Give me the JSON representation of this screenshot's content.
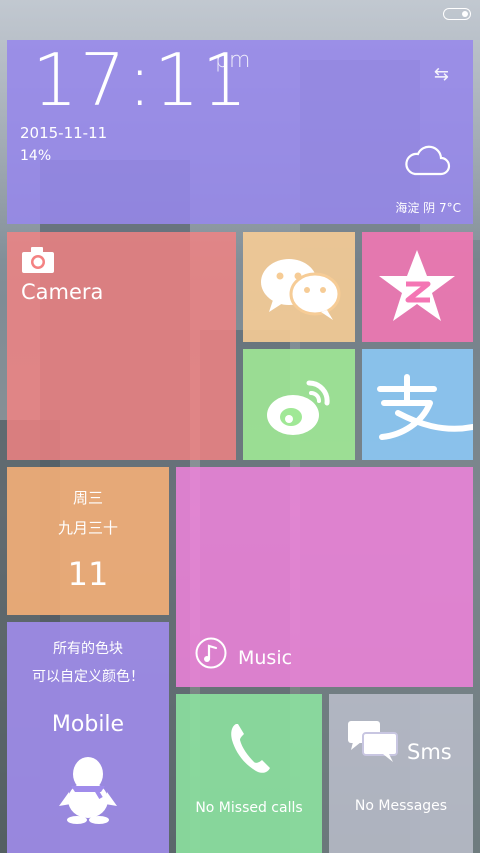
{
  "clock": {
    "time": "17:11",
    "ampm": "pm",
    "date": "2015-11-11",
    "battery": "14%",
    "weather": "海淀 阴 7°C"
  },
  "camera": {
    "label": "Camera"
  },
  "calendar": {
    "weekday": "周三",
    "lunar": "九月三十",
    "day": "11"
  },
  "music": {
    "label": "Music"
  },
  "mobile": {
    "note_line1": "所有的色块",
    "note_line2": "可以自定义颜色！",
    "label": "Mobile"
  },
  "calls": {
    "label": "No Missed calls"
  },
  "sms": {
    "label": "Sms",
    "sub": "No Messages"
  },
  "icons": {
    "wechat": "wechat-icon",
    "qzone": "qzone-star-icon",
    "weibo": "weibo-icon",
    "alipay": "alipay-icon"
  }
}
